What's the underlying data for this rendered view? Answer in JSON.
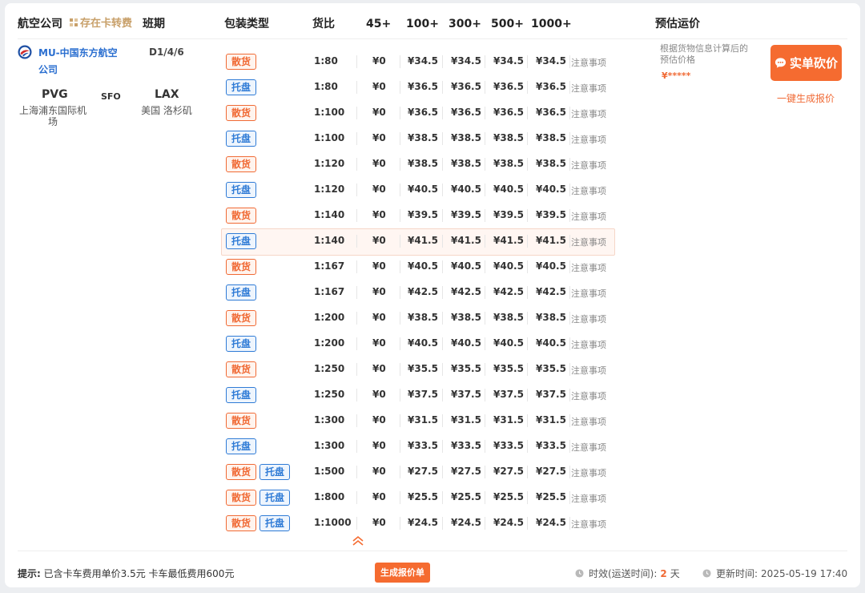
{
  "headers": {
    "airline": "航空公司",
    "warn": "存在卡转费",
    "schedule": "班期",
    "package": "包装类型",
    "ratio": "货比",
    "b45": "45+",
    "b100": "100+",
    "b300": "300+",
    "b500": "500+",
    "b1000": "1000+",
    "estimate": "预估运价"
  },
  "route": {
    "airline_name": "MU-中国东方航空公司",
    "schedule": "D1/4/6",
    "origin_code": "PVG",
    "origin_city": "上海浦东国际机场",
    "via": "SFO",
    "dest_code": "LAX",
    "dest_city": "美国 洛杉矶"
  },
  "labels": {
    "loose": "散货",
    "pallet": "托盘",
    "note": "注意事项"
  },
  "rates": [
    {
      "pkgs": [
        "loose"
      ],
      "ratio": "1:80",
      "p45": "¥0",
      "p100": "¥34.5",
      "p300": "¥34.5",
      "p500": "¥34.5",
      "p1000": "¥34.5"
    },
    {
      "pkgs": [
        "pallet"
      ],
      "ratio": "1:80",
      "p45": "¥0",
      "p100": "¥36.5",
      "p300": "¥36.5",
      "p500": "¥36.5",
      "p1000": "¥36.5"
    },
    {
      "pkgs": [
        "loose"
      ],
      "ratio": "1:100",
      "p45": "¥0",
      "p100": "¥36.5",
      "p300": "¥36.5",
      "p500": "¥36.5",
      "p1000": "¥36.5"
    },
    {
      "pkgs": [
        "pallet"
      ],
      "ratio": "1:100",
      "p45": "¥0",
      "p100": "¥38.5",
      "p300": "¥38.5",
      "p500": "¥38.5",
      "p1000": "¥38.5"
    },
    {
      "pkgs": [
        "loose"
      ],
      "ratio": "1:120",
      "p45": "¥0",
      "p100": "¥38.5",
      "p300": "¥38.5",
      "p500": "¥38.5",
      "p1000": "¥38.5"
    },
    {
      "pkgs": [
        "pallet"
      ],
      "ratio": "1:120",
      "p45": "¥0",
      "p100": "¥40.5",
      "p300": "¥40.5",
      "p500": "¥40.5",
      "p1000": "¥40.5"
    },
    {
      "pkgs": [
        "loose"
      ],
      "ratio": "1:140",
      "p45": "¥0",
      "p100": "¥39.5",
      "p300": "¥39.5",
      "p500": "¥39.5",
      "p1000": "¥39.5"
    },
    {
      "pkgs": [
        "pallet"
      ],
      "ratio": "1:140",
      "p45": "¥0",
      "p100": "¥41.5",
      "p300": "¥41.5",
      "p500": "¥41.5",
      "p1000": "¥41.5",
      "highlighted": true
    },
    {
      "pkgs": [
        "loose"
      ],
      "ratio": "1:167",
      "p45": "¥0",
      "p100": "¥40.5",
      "p300": "¥40.5",
      "p500": "¥40.5",
      "p1000": "¥40.5"
    },
    {
      "pkgs": [
        "pallet"
      ],
      "ratio": "1:167",
      "p45": "¥0",
      "p100": "¥42.5",
      "p300": "¥42.5",
      "p500": "¥42.5",
      "p1000": "¥42.5"
    },
    {
      "pkgs": [
        "loose"
      ],
      "ratio": "1:200",
      "p45": "¥0",
      "p100": "¥38.5",
      "p300": "¥38.5",
      "p500": "¥38.5",
      "p1000": "¥38.5"
    },
    {
      "pkgs": [
        "pallet"
      ],
      "ratio": "1:200",
      "p45": "¥0",
      "p100": "¥40.5",
      "p300": "¥40.5",
      "p500": "¥40.5",
      "p1000": "¥40.5"
    },
    {
      "pkgs": [
        "loose"
      ],
      "ratio": "1:250",
      "p45": "¥0",
      "p100": "¥35.5",
      "p300": "¥35.5",
      "p500": "¥35.5",
      "p1000": "¥35.5"
    },
    {
      "pkgs": [
        "pallet"
      ],
      "ratio": "1:250",
      "p45": "¥0",
      "p100": "¥37.5",
      "p300": "¥37.5",
      "p500": "¥37.5",
      "p1000": "¥37.5"
    },
    {
      "pkgs": [
        "loose"
      ],
      "ratio": "1:300",
      "p45": "¥0",
      "p100": "¥31.5",
      "p300": "¥31.5",
      "p500": "¥31.5",
      "p1000": "¥31.5"
    },
    {
      "pkgs": [
        "pallet"
      ],
      "ratio": "1:300",
      "p45": "¥0",
      "p100": "¥33.5",
      "p300": "¥33.5",
      "p500": "¥33.5",
      "p1000": "¥33.5"
    },
    {
      "pkgs": [
        "loose",
        "pallet"
      ],
      "ratio": "1:500",
      "p45": "¥0",
      "p100": "¥27.5",
      "p300": "¥27.5",
      "p500": "¥27.5",
      "p1000": "¥27.5"
    },
    {
      "pkgs": [
        "loose",
        "pallet"
      ],
      "ratio": "1:800",
      "p45": "¥0",
      "p100": "¥25.5",
      "p300": "¥25.5",
      "p500": "¥25.5",
      "p1000": "¥25.5"
    },
    {
      "pkgs": [
        "loose",
        "pallet"
      ],
      "ratio": "1:1000",
      "p45": "¥0",
      "p100": "¥24.5",
      "p300": "¥24.5",
      "p500": "¥24.5",
      "p1000": "¥24.5"
    }
  ],
  "estimate": {
    "desc": "根据货物信息计算后的预估价格",
    "masked_price": "¥*****",
    "bargain_label": "实单砍价",
    "quick_quote_label": "一键生成报价"
  },
  "footer": {
    "tip_label": "提示:",
    "tip_text": "已含卡车费用单价3.5元 卡车最低费用600元",
    "generate_button": "生成报价单",
    "transit_label": "时效(运送时间):",
    "transit_days": "2",
    "transit_unit": "天",
    "update_label": "更新时间:",
    "update_time": "2025-05-19 17:40"
  },
  "colors": {
    "accent": "#f56b30",
    "link_blue": "#2b6fd0",
    "pallet_blue": "#2f7bd6",
    "warn_gold": "#c8a06a"
  }
}
